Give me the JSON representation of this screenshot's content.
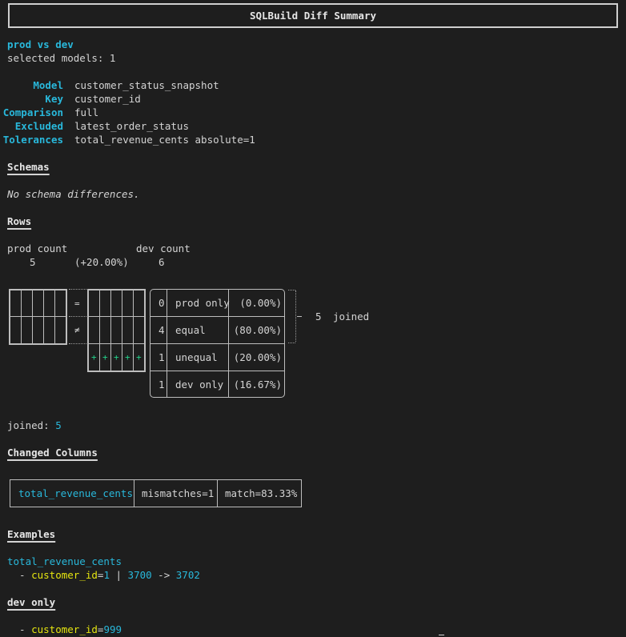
{
  "title": "SQLBuild Diff Summary",
  "comparison_header": "prod vs dev",
  "selected_models": "selected models: 1",
  "meta": [
    {
      "key": "Model",
      "value": "customer_status_snapshot"
    },
    {
      "key": "Key",
      "value": "customer_id"
    },
    {
      "key": "Comparison",
      "value": "full"
    },
    {
      "key": "Excluded",
      "value": "latest_order_status"
    },
    {
      "key": "Tolerances",
      "value": "total_revenue_cents absolute=1"
    }
  ],
  "schemas": {
    "heading": "Schemas",
    "message": "No schema differences."
  },
  "rows": {
    "heading": "Rows",
    "prod_count_label": "prod count",
    "dev_count_label": "dev count",
    "prod_count": "5",
    "change": "(+20.00%)",
    "dev_count": "6",
    "eq_symbol": "=",
    "neq_symbol": "≠",
    "plus_symbol": "+",
    "joined_count": "5",
    "joined_label": "joined",
    "breakdown": [
      {
        "count": "0",
        "label": "prod only",
        "pct": "(0.00%)"
      },
      {
        "count": "4",
        "label": "equal",
        "pct": "(80.00%)"
      },
      {
        "count": "1",
        "label": "unequal",
        "pct": "(20.00%)"
      },
      {
        "count": "1",
        "label": "dev only",
        "pct": "(16.67%)"
      }
    ],
    "joined_summary_label": "joined: ",
    "joined_summary_value": "5"
  },
  "changed_columns": {
    "heading": "Changed Columns",
    "items": [
      {
        "column": "total_revenue_cents",
        "mismatches": "mismatches=1",
        "match": "match=83.33%"
      }
    ]
  },
  "examples": {
    "heading": "Examples",
    "column": "total_revenue_cents",
    "bullet": "  - ",
    "key_label": "customer_id",
    "eq": "=",
    "key_value": "1",
    "sep": " | ",
    "old_value": "3700",
    "arrow": " -> ",
    "new_value": "3702"
  },
  "dev_only": {
    "heading": "dev only",
    "bullet": "  - ",
    "key_label": "customer_id",
    "eq": "=",
    "key_value": "999"
  },
  "colors": {
    "background": "#1e1e1e",
    "text": "#d4d4d4",
    "accent_cyan": "#29b8db",
    "accent_yellow": "#e5e510",
    "accent_green": "#23d18b"
  }
}
